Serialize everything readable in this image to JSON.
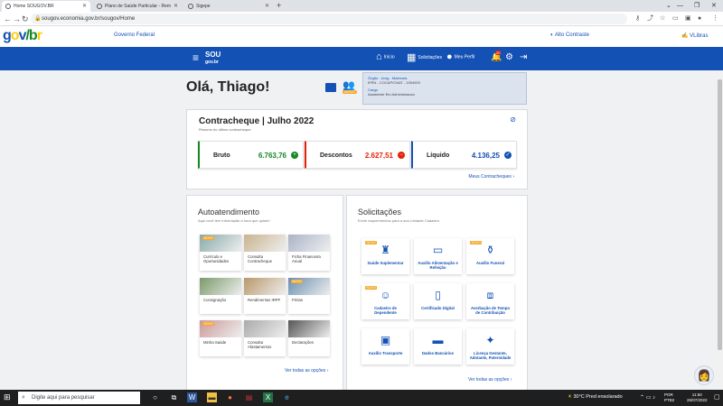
{
  "browser": {
    "tabs": [
      {
        "label": "Home SOUGOV.BR"
      },
      {
        "label": "Plano de Saúde Particular - Rem"
      },
      {
        "label": "Sigepe"
      }
    ],
    "url": "sougov.economia.gov.br/sougov/Home"
  },
  "gov_header": {
    "logo": {
      "g": "g",
      "o": "o",
      "v": "v",
      "slash": "/",
      "b": "b",
      "r": "r"
    },
    "governo": "Governo Federal",
    "alto_contraste": "Alto Contraste",
    "vlibras": "VLibras"
  },
  "topbar": {
    "logo_top": "SOU",
    "logo_bottom": "gov.br",
    "nav": [
      {
        "label": "Início"
      },
      {
        "label": "Solicitações"
      },
      {
        "label": "Meu Perfil"
      }
    ],
    "notif_count": "20"
  },
  "greeting": "Olá, Thiago!",
  "novo_badge": "NOVO",
  "org_info": {
    "org_label": "Órgão - Uorg - Matrícula",
    "org_value": "IFRN - COCAP/CNAT - 1904929",
    "cargo_label": "Cargo",
    "cargo_value": "Assistente Em Administracao"
  },
  "contracheque": {
    "title": "Contracheque | Julho 2022",
    "subtitle": "Resumo do último contracheque",
    "bruto": {
      "label": "Bruto",
      "value": "6.763,76",
      "color": "#168821"
    },
    "descontos": {
      "label": "Descontos",
      "value": "2.627,51",
      "color": "#e52207"
    },
    "liquido": {
      "label": "Líquido",
      "value": "4.136,25",
      "color": "#1351b4"
    },
    "more": "Meus Contracheques"
  },
  "autoatendimento": {
    "title": "Autoatendimento",
    "subtitle": "Aqui você tem informação a hora que quiser!",
    "items": [
      {
        "label": "Currículo e Oportunidades",
        "novo": true
      },
      {
        "label": "Consulta Contracheque",
        "novo": false
      },
      {
        "label": "Ficha Financeira Anual",
        "novo": false
      },
      {
        "label": "Consignação",
        "novo": false
      },
      {
        "label": "Rendimentos IRPF",
        "novo": false
      },
      {
        "label": "Férias",
        "novo": true
      },
      {
        "label": "Minha Saúde",
        "novo": true
      },
      {
        "label": "Consulta Afastamentos",
        "novo": false
      },
      {
        "label": "Declarações",
        "novo": false
      }
    ],
    "more": "Ver todas as opções"
  },
  "solicitacoes": {
    "title": "Solicitações",
    "subtitle": "Envie requerimentos para a sua Unidade Cadastro",
    "items": [
      {
        "label": "Saúde Suplementar",
        "icon": "health-plan-icon",
        "novo": true
      },
      {
        "label": "Auxílio Alimentação e Refeição",
        "icon": "card-icon",
        "novo": false
      },
      {
        "label": "Auxílio Funeral",
        "icon": "funeral-icon",
        "novo": true
      },
      {
        "label": "Cadastro de Dependente",
        "icon": "dependent-icon",
        "novo": true
      },
      {
        "label": "Certificado Digital",
        "icon": "certificate-icon",
        "novo": false
      },
      {
        "label": "Averbação de Tempo de Contribuição",
        "icon": "briefcase-icon",
        "novo": false
      },
      {
        "label": "Auxílio Transporte",
        "icon": "bus-icon",
        "novo": false
      },
      {
        "label": "Dados Bancários",
        "icon": "money-icon",
        "novo": false
      },
      {
        "label": "Licença Gestante, Adotante, Paternidade",
        "icon": "child-icon",
        "novo": false
      }
    ],
    "more": "Ver todas as opções"
  },
  "taskbar": {
    "search_placeholder": "Digite aqui para pesquisar",
    "weather": "30°C  Pred ensolarado",
    "lang_top": "POR",
    "lang_bottom": "PTB2",
    "time": "11:50",
    "date": "26/07/2022"
  }
}
